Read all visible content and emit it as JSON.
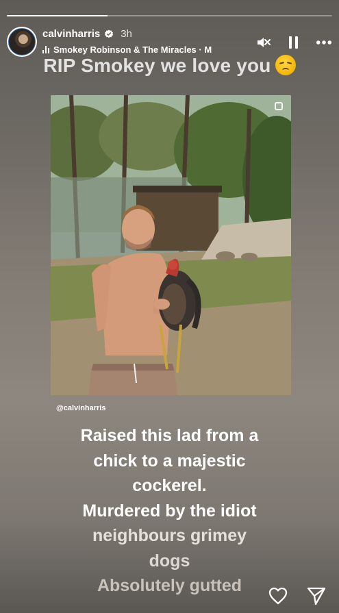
{
  "progress": {
    "segments": 1,
    "current_fraction": 0.31
  },
  "header": {
    "username": "calvinharris",
    "verified": true,
    "time_ago": "3h",
    "music": "Smokey Robinson & The Miracles · M",
    "icons": [
      "mute-speaker-icon",
      "pause-icon",
      "more-options-icon"
    ]
  },
  "caption_top": "RIP Smokey we love you",
  "caption_emoji": "disappointed-face-emoji",
  "photo": {
    "type": "shared-post-photo"
  },
  "mention": "@calvinharris",
  "caption_body": [
    {
      "text": "Raised this lad from a",
      "color": "#ffffff"
    },
    {
      "text": "chick to a majestic",
      "color": "#ffffff"
    },
    {
      "text": "cockerel.",
      "color": "#ffffff"
    },
    {
      "text": "Murdered by the idiot",
      "color": "#ffffff"
    },
    {
      "text": "neighbours grimey",
      "color": "#e4e0da"
    },
    {
      "text": "dogs",
      "color": "#ddd8d1"
    },
    {
      "text": "Absolutely gutted",
      "color": "#c8c2b9"
    }
  ],
  "bottom_actions": [
    "heart-icon",
    "send-icon"
  ]
}
